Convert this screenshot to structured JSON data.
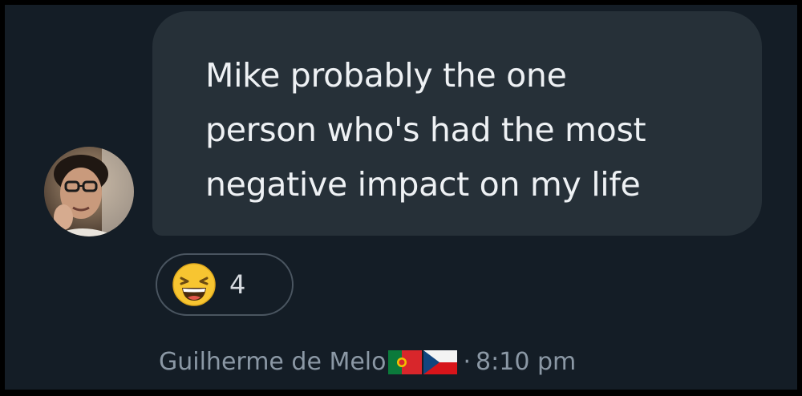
{
  "message": {
    "text": "Mike probably the one\nperson who's had the most\nnegative impact on my life"
  },
  "reaction": {
    "emoji": "laughing-emoji",
    "count": "4"
  },
  "meta": {
    "author": "Guilherme de Melo",
    "flags": [
      "portugal-flag",
      "czech-flag"
    ],
    "separator": "·",
    "time": "8:10 pm"
  },
  "colors": {
    "background": "#141d26",
    "bubble": "#263038",
    "text": "#eef1f4",
    "meta_text": "#8b98a5"
  }
}
